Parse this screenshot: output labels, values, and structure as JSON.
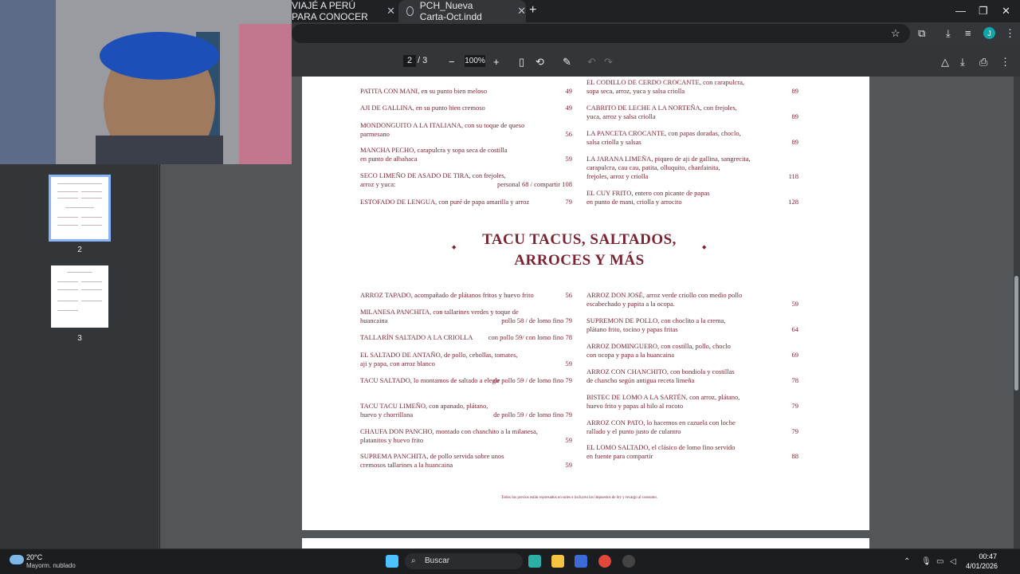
{
  "browser": {
    "tabs": [
      {
        "label": "VIAJÉ A PERÚ PARA CONOCER",
        "close": "✕"
      },
      {
        "label": "PCH_Nueva Carta-Oct.indd",
        "close": "✕"
      }
    ],
    "new_tab": "+",
    "window_controls": {
      "minimize": "—",
      "maximize": "❐",
      "close": "✕"
    },
    "icons": [
      "star-icon",
      "extension-icon",
      "download-icon",
      "media-icon"
    ],
    "avatar_initial": "J"
  },
  "pdf_toolbar": {
    "page_current": "2",
    "page_total": "/ 3",
    "zoom": "100%",
    "zoom_out": "−",
    "zoom_in": "+"
  },
  "sidebar": {
    "thumbnails": [
      {
        "label": "2",
        "active": true
      },
      {
        "label": "3",
        "active": false
      }
    ]
  },
  "menu": {
    "left_top": [
      {
        "name": "PATITA CON MANI, en su punto bien meloso",
        "price": "49"
      },
      {
        "name": "AJI DE GALLINA, en su punto bien cremoso",
        "price": "49"
      },
      {
        "name": "MONDONGUITO A LA ITALIANA, con su toque de queso",
        "name2": "parmesano",
        "price": "56"
      },
      {
        "name": "MANCHA PECHO, carapulcra y sopa seca de costilla",
        "name2": "en punto de albahaca",
        "price": "59"
      },
      {
        "name": "SECO LIMEÑO DE ASADO DE TIRA, con frejoles,",
        "name2": "arroz y yuca:",
        "price": "personal 68 / compartir 108"
      },
      {
        "name": "ESTOFADO DE LENGUA, con puré de papa amarilla y arroz",
        "price": "79"
      }
    ],
    "right_top": [
      {
        "name": "EL CODILLO DE CERDO CROCANTE, con carapulcra,",
        "name2": "sopa seca, arroz, yuca y salsa criolla",
        "price": "89"
      },
      {
        "name": "CABRITO DE LECHE A LA NORTEÑA, con frejoles,",
        "name2": "yuca, arroz y salsa criolla",
        "price": "89"
      },
      {
        "name": "LA PANCETA CROCANTE, con papas doradas, choclo,",
        "name2": "salsa criolla y salsas",
        "price": "89"
      },
      {
        "name": "LA JARANA LIMEÑA, piqueo de aji de gallina,  sangrecita,",
        "name2": "carapulcra, cau cau, patita, olluquito, chanfainita,",
        "name3": "frejoles, arroz y criolla",
        "price": "118"
      },
      {
        "name": "EL CUY FRITO, entero  con picante de papas",
        "name2": "en punto de mani,  criolla y arrocito",
        "price": "128"
      }
    ],
    "section_title_1": "TACU TACUS, SALTADOS,",
    "section_title_2": "ARROCES Y MÁS",
    "left_bottom": [
      {
        "name": "ARROZ TAPADO, acompañado de plátanos fritos y huevo frito",
        "price": "56"
      },
      {
        "name": "MILANESA PANCHITA, con tallarines verdes y toque de",
        "name2": "huancaina",
        "price": "pollo 58 / de lomo fino 79"
      },
      {
        "name": "TALLARÍN SALTADO A LA CRIOLLA",
        "price": "con pollo 59/ con lomo fino 78"
      },
      {
        "name": "EL SALTADO DE ANTAÑO, de pollo, cebollas, tomates,",
        "name2": "aji y papa, con arroz blanco",
        "price": "59"
      },
      {
        "name": "TACU SALTADO, lo montamos de saltado a elegir",
        "price": "de pollo 59 / de lomo fino 79"
      },
      {
        "name": "TACU TACU LIMEÑO, con apanado, plátano,",
        "name2": "huevo y chorrillana",
        "price": "de pollo 59 / de lomo fino 79"
      },
      {
        "name": "CHAUFA DON PANCHO, montado con chanchito a la milanesa,",
        "name2": "platanitos y huevo frito",
        "price": "59"
      },
      {
        "name": "SUPREMA PANCHITA, de pollo servida sobre unos",
        "name2": "cremosos tallarines a la huancaina",
        "price": "59"
      }
    ],
    "right_bottom": [
      {
        "name": "ARROZ DON JOSÉ, arroz verde criollo con medio pollo",
        "name2": "escabechado y papita a la ocopa.",
        "price": "59"
      },
      {
        "name": "SUPREMON DE POLLO, con choclito a la crema,",
        "name2": "plátano frito, tocino y papas fritas",
        "price": "64"
      },
      {
        "name": "ARROZ DOMINGUERO, con costilla, pollo, choclo",
        "name2": "con ocopa y papa a la huancaina",
        "price": "69"
      },
      {
        "name": "ARROZ CON CHANCHITO, con bondiola y costillas",
        "name2": "de chancho según antigua receta limeña",
        "price": "78"
      },
      {
        "name": "BISTEC DE LOMO A LA SARTÉN, con arroz, plátano,",
        "name2": "huevo frito y papas al hilo al rocoto",
        "price": "79"
      },
      {
        "name": "ARROZ CON PATO, lo hacemos en cazuela con loche",
        "name2": "rallado y el punto justo de culantro",
        "price": "79"
      },
      {
        "name": "EL LOMO SALTADO, el clásico de lomo fino servido",
        "name2": "en fuente para compartir",
        "price": "88"
      }
    ],
    "footer": "Todos los precios están expresados en soles e incluyen los impuestos de ley y recargo al consumo."
  },
  "taskbar": {
    "weather_temp": "20°C",
    "weather_desc": "Mayorm. nublado",
    "search_label": "Buscar",
    "time": "00:47",
    "date": "4/01/2026"
  },
  "colors": {
    "menu_text": "#7a2432",
    "toolbar": "#323639",
    "viewer_bg": "#525659"
  }
}
